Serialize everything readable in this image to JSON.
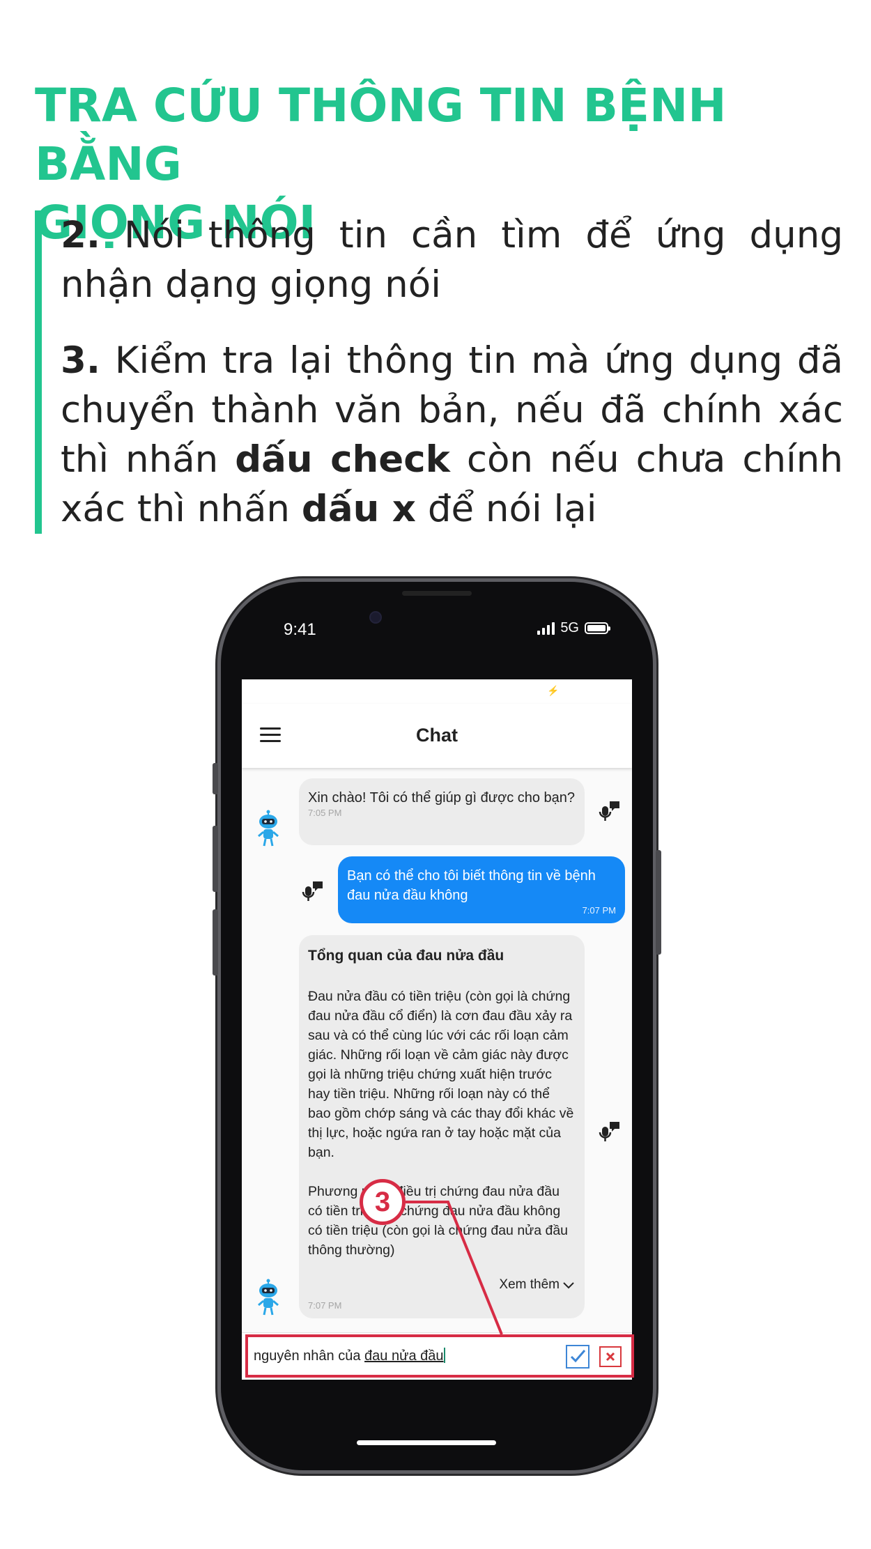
{
  "header": {
    "title_line1": "TRA CỨU THÔNG TIN BỆNH BẰNG",
    "title_line2": "GIỌNG NÓI"
  },
  "steps": [
    {
      "number": "2.",
      "text": "Nói thông tin cần tìm để ứng dụng nhận dạng giọng nói"
    },
    {
      "number": "3.",
      "text_a": "Kiểm tra lại thông tin mà ứng dụng đã chuyển thành văn bản, nếu đã chính xác thì nhấn",
      "bold_a": "dấu check",
      "text_b": "còn nếu chưa chính xác thì nhấn",
      "bold_b": "dấu x",
      "text_c": "để nói lại"
    }
  ],
  "phone": {
    "status_time": "9:41",
    "network": "5G"
  },
  "app": {
    "title": "Chat",
    "messages": [
      {
        "role": "bot",
        "text": "Xin chào! Tôi có thể giúp gì được cho bạn?",
        "time": "7:05 PM"
      },
      {
        "role": "user",
        "text": "Bạn có thể cho tôi biết thông tin về bệnh đau nửa đầu không",
        "time": "7:07 PM"
      },
      {
        "role": "bot",
        "title": "Tổng quan của đau nửa đầu",
        "body": "  Đau nửa đầu có tiền triệu (còn gọi là chứng đau nửa đầu cổ điển) là cơn đau đầu xảy ra sau và có thể cùng lúc với các rối loạn cảm giác. Những rối loạn về cảm giác này được gọi là những triệu chứng xuất hiện trước hay tiền triệu. Những rối loạn này có thể bao gồm chớp sáng và các thay đổi khác về thị lực, hoặc ngứa ran ở tay hoặc mặt của bạn.\n\n  Phương pháp điều trị chứng đau nửa đầu có tiền triệu và chứng đau nửa đầu không có tiền triệu (còn gọi là chứng đau nửa đầu thông thường)",
        "see_more": "Xem thêm",
        "time": "7:07 PM"
      }
    ],
    "input": {
      "prefix": "nguyên nhân của ",
      "underlined": "đau nửa đầu"
    }
  },
  "annotation": {
    "badge": "3",
    "color": "#d72c45"
  },
  "colors": {
    "accent": "#22c58f",
    "user_bubble": "#1589f6",
    "bot_bubble": "#ececec"
  }
}
